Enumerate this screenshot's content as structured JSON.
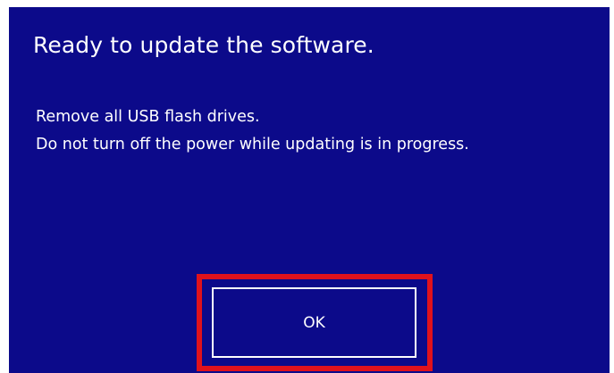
{
  "dialog": {
    "title": "Ready to update the software.",
    "messages": [
      "Remove all USB flash drives.",
      "Do not turn off the power while updating is in progress."
    ],
    "ok_label": "OK"
  },
  "colors": {
    "background": "#0c0a8a",
    "text": "#ffffff",
    "highlight_border": "#e0121c"
  }
}
